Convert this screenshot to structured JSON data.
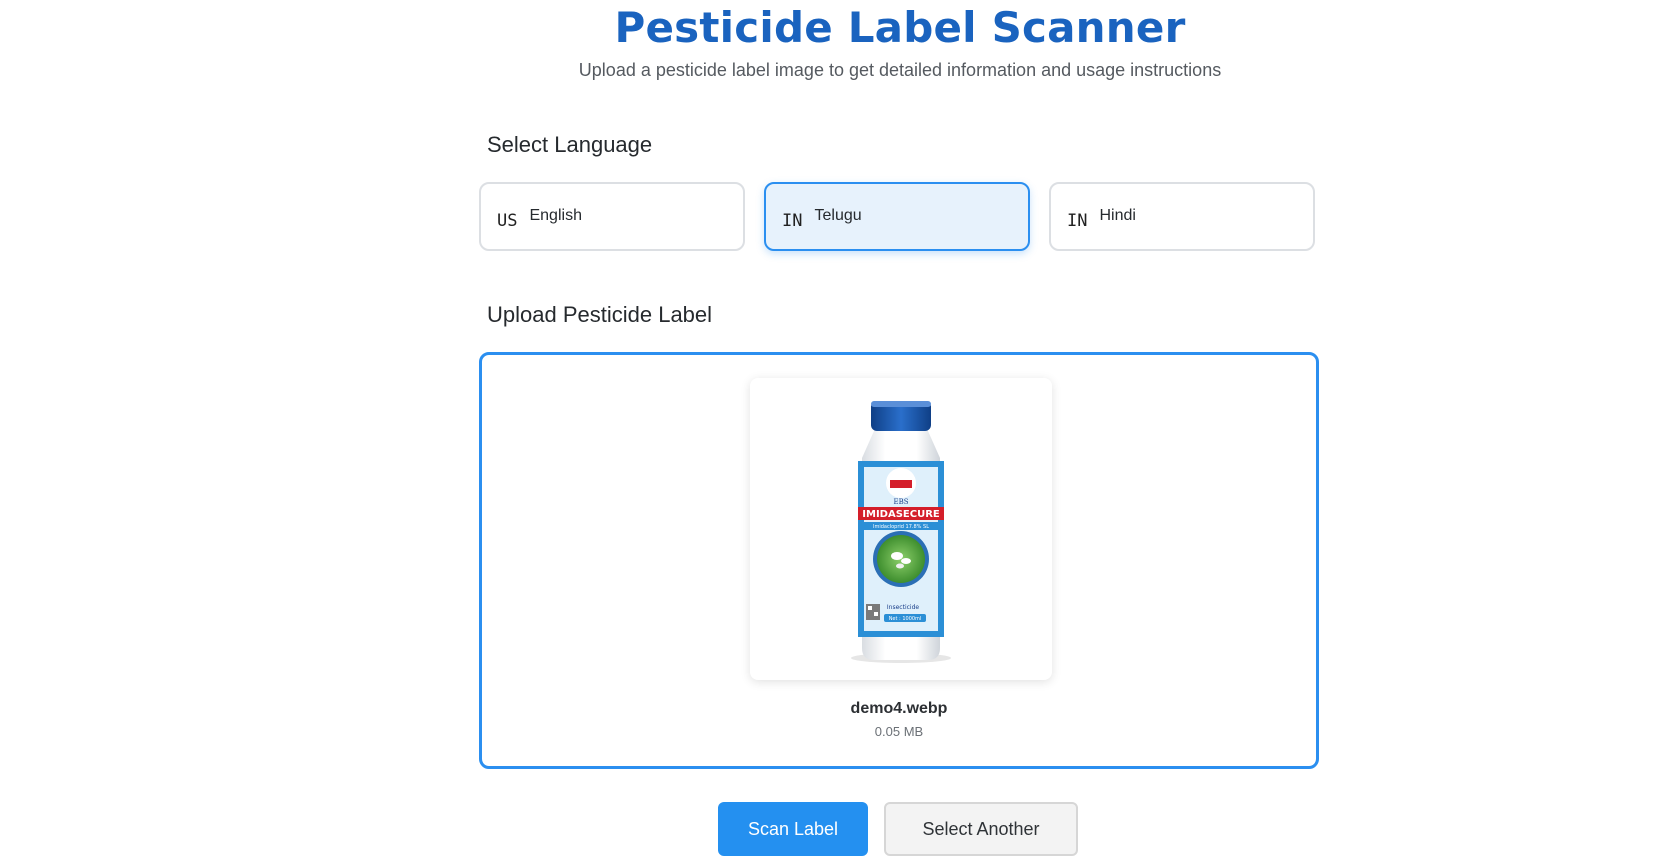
{
  "header": {
    "title": "Pesticide Label Scanner",
    "subtitle": "Upload a pesticide label image to get detailed information and usage instructions"
  },
  "language": {
    "heading": "Select Language",
    "options": [
      {
        "flag": "US",
        "label": "English",
        "selected": false
      },
      {
        "flag": "IN",
        "label": "Telugu",
        "selected": true
      },
      {
        "flag": "IN",
        "label": "Hindi",
        "selected": false
      }
    ]
  },
  "upload": {
    "heading": "Upload Pesticide Label",
    "file_name": "demo4.webp",
    "file_size": "0.05 MB",
    "product": {
      "brand": "EBS",
      "name": "IMIDASECURE",
      "formulation": "Imidacloprid 17.8% SL",
      "category": "Insecticide",
      "net": "Net : 1000ml"
    }
  },
  "actions": {
    "scan_label": "Scan Label",
    "select_another": "Select Another"
  },
  "colors": {
    "accent": "#2490f0",
    "title": "#1a63bf",
    "selected_bg": "#e7f2fc"
  }
}
